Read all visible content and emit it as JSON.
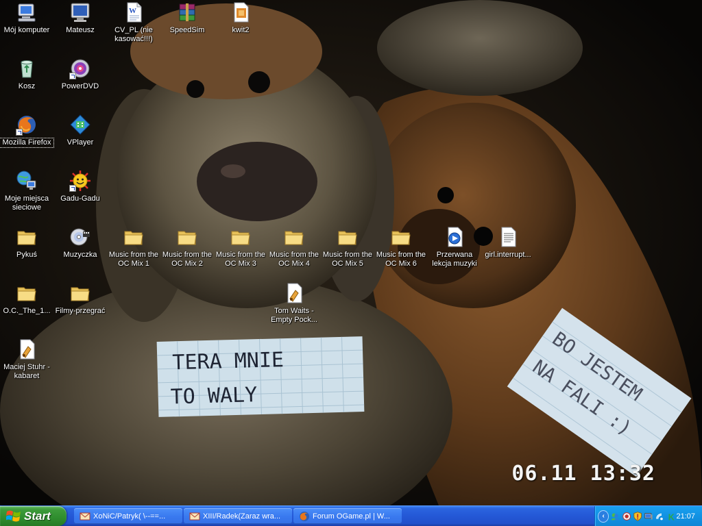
{
  "desktop": {
    "icons": [
      {
        "label": "Mój komputer",
        "icon": "my-computer-icon"
      },
      {
        "label": "Mateusz",
        "icon": "user-folder-icon"
      },
      {
        "label": "CV_PL (nie kasować!!!)",
        "icon": "word-document-icon"
      },
      {
        "label": "SpeedSim",
        "icon": "winrar-archive-icon"
      },
      {
        "label": "kwit2",
        "icon": "image-file-icon"
      },
      {
        "label": "Kosz",
        "icon": "recycle-bin-icon"
      },
      {
        "label": "PowerDVD",
        "icon": "powerdvd-icon"
      },
      {
        "label": "Mozilla Firefox",
        "icon": "firefox-icon"
      },
      {
        "label": "VPlayer",
        "icon": "vplayer-icon"
      },
      {
        "label": "Moje miejsca sieciowe",
        "icon": "network-places-icon"
      },
      {
        "label": "Gadu-Gadu",
        "icon": "gadu-gadu-icon"
      },
      {
        "label": "Pykuś",
        "icon": "folder-icon"
      },
      {
        "label": "Muzyczka",
        "icon": "music-cd-icon"
      },
      {
        "label": "Music from the OC Mix 1",
        "icon": "folder-icon"
      },
      {
        "label": "Music from the OC Mix 2",
        "icon": "folder-icon"
      },
      {
        "label": "Music from the OC Mix 3",
        "icon": "folder-icon"
      },
      {
        "label": "Music from the OC Mix 4",
        "icon": "folder-icon"
      },
      {
        "label": "Music from the OC Mix 5",
        "icon": "folder-icon"
      },
      {
        "label": "Music from the OC Mix 6",
        "icon": "folder-icon"
      },
      {
        "label": "Przerwana lekcja muzyki",
        "icon": "media-file-icon"
      },
      {
        "label": "girl.interrupt...",
        "icon": "text-file-icon"
      },
      {
        "label": "O.C._The_1...",
        "icon": "folder-icon"
      },
      {
        "label": "Filmy-przegrać",
        "icon": "folder-icon"
      },
      {
        "label": "Tom Waits - Empty Pock...",
        "icon": "audio-file-icon"
      },
      {
        "label": "Maciej Stuhr - kabaret",
        "icon": "audio-file-icon"
      }
    ],
    "wallpaper": {
      "note_left": [
        "TERA MNIE",
        "TO WALY"
      ],
      "note_right": [
        "BO JESTEM",
        "NA FALI :)"
      ]
    },
    "camera_datestamp": "06.11 13:32"
  },
  "taskbar": {
    "start_label": "Start",
    "tasks": [
      {
        "label": "XoNiC/Patryk( \\--==...",
        "icon": "mail-icon"
      },
      {
        "label": "XIII/Radek(Zaraz wra...",
        "icon": "mail-icon"
      },
      {
        "label": "Forum OGame.pl | W...",
        "icon": "firefox-icon"
      }
    ],
    "tray": {
      "icons": [
        "show-hidden-icons-chevron",
        "messenger-icon",
        "antivirus-icon",
        "security-shield-icon",
        "monitor-icon",
        "network-connection-icon",
        "k-icon"
      ],
      "clock": "21:07"
    }
  },
  "colors": {
    "taskbar_blue": "#2458d6",
    "start_green": "#2f8d2e",
    "tray_blue": "#1292e3"
  }
}
